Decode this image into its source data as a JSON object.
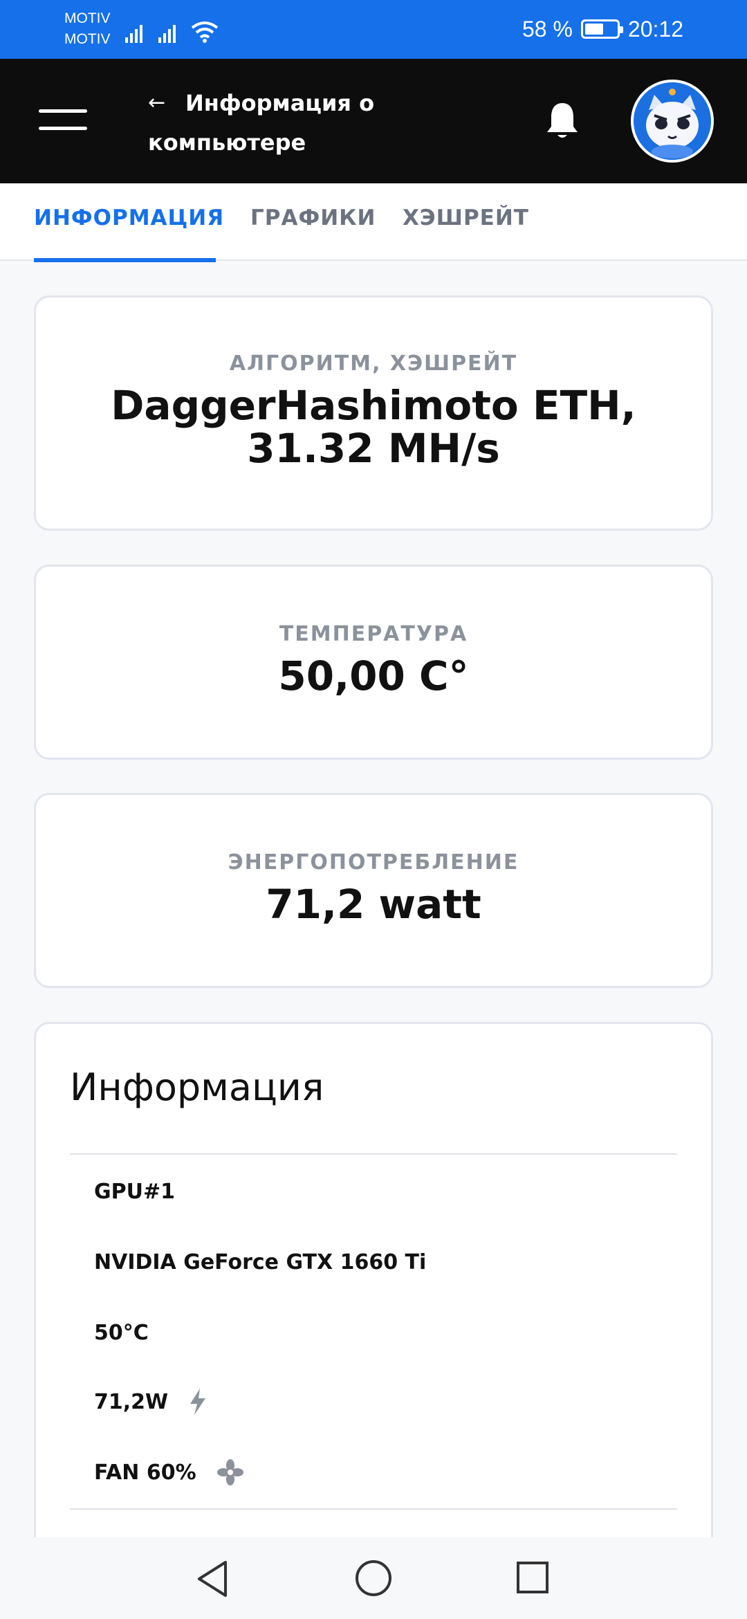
{
  "status_bar": {
    "carrier1": "MOTIV",
    "carrier2": "MOTIV",
    "battery_percent": "58 %",
    "battery_level": 0.58,
    "time": "20:12"
  },
  "header": {
    "title": "Информация о компьютере",
    "back_icon": "arrow-left-icon",
    "menu_icon": "hamburger-icon",
    "bell_icon": "bell-icon"
  },
  "tabs": [
    {
      "label": "ИНФОРМАЦИЯ",
      "active": true
    },
    {
      "label": "ГРАФИКИ",
      "active": false
    },
    {
      "label": "ХЭШРЕЙТ",
      "active": false
    }
  ],
  "cards": {
    "algo_label": "АЛГОРИТМ, ХЭШРЕЙТ",
    "algo_value_line1": "DaggerHashimoto ETH,",
    "algo_value_line2": "31.32 MH/s",
    "temp_label": "ТЕМПЕРАТУРА",
    "temp_value": "50,00 C°",
    "power_label": "ЭНЕРГОПОТРЕБЛЕНИЕ",
    "power_value": "71,2 watt"
  },
  "info": {
    "title": "Информация",
    "gpu": "GPU#1",
    "model": "NVIDIA GeForce GTX 1660 Ti",
    "temperature": "50°C",
    "power": "71,2W",
    "fan": "FAN 60%"
  },
  "colors": {
    "accent": "#1570ea",
    "header_bg": "#0d0d0d",
    "label_gray": "#8c929c"
  }
}
